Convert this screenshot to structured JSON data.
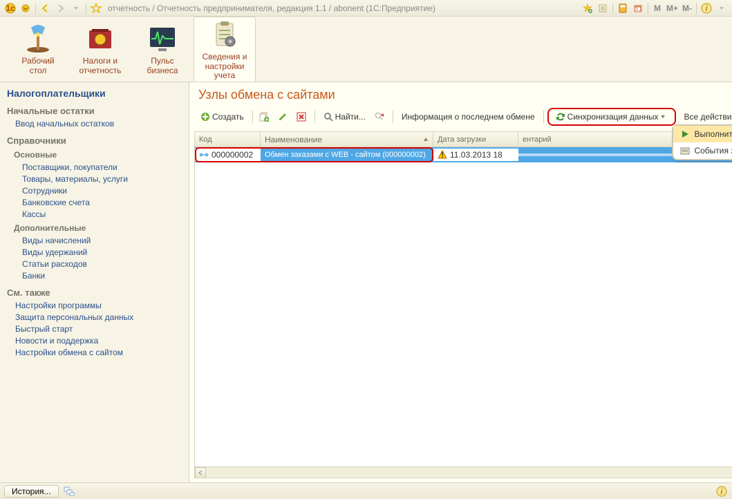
{
  "titlebar": {
    "text": "отчетность / Отчетность предпринимателя, редакция 1.1 / abonent (1C:Предприятие)",
    "buttons": {
      "m": "M",
      "mplus": "M+",
      "mminus": "M-"
    }
  },
  "sections": [
    {
      "label": "Рабочий\nстол"
    },
    {
      "label": "Налоги и\nотчетность"
    },
    {
      "label": "Пульс\nбизнеса"
    },
    {
      "label": "Сведения и\nнастройки учета",
      "active": true
    }
  ],
  "leftnav": {
    "heading": "Налогоплательщики",
    "groups": [
      {
        "title": "Начальные остатки",
        "links": [
          {
            "text": "Ввод начальных остатков"
          }
        ]
      },
      {
        "title": "Справочники",
        "subgroups": [
          {
            "subtitle": "Основные",
            "links": [
              {
                "text": "Поставщики, покупатели"
              },
              {
                "text": "Товары, материалы, услуги"
              },
              {
                "text": "Сотрудники"
              },
              {
                "text": "Банковские счета"
              },
              {
                "text": "Кассы"
              }
            ]
          },
          {
            "subtitle": "Дополнительные",
            "links": [
              {
                "text": "Виды начислений"
              },
              {
                "text": "Виды удержаний"
              },
              {
                "text": "Статьи расходов"
              },
              {
                "text": "Банки"
              }
            ]
          }
        ]
      },
      {
        "title": "См. также",
        "links": [
          {
            "text": "Настройки программы"
          },
          {
            "text": "Защита персональных данных"
          },
          {
            "text": "Быстрый старт"
          },
          {
            "text": "Новости и поддержка"
          },
          {
            "text": "Настройки обмена с сайтом"
          }
        ]
      }
    ]
  },
  "page": {
    "title": "Узлы обмена с сайтами",
    "toolbar": {
      "create": "Создать",
      "find": "Найти...",
      "info": "Информация о последнем обмене",
      "sync": "Синхронизация данных",
      "all_actions": "Все действия"
    },
    "dropdown": {
      "run": "Выполнить обмен данными",
      "events": "События загрузки данных"
    },
    "columns": {
      "code": "Код",
      "name": "Наименование",
      "date": "Дата загрузки",
      "comment": "ентарий"
    },
    "rows": [
      {
        "code": "000000002",
        "name": "Обмен заказами с WEB - сайтом (000000002)",
        "date": "11.03.2013 18"
      }
    ]
  },
  "statusbar": {
    "history": "История..."
  }
}
